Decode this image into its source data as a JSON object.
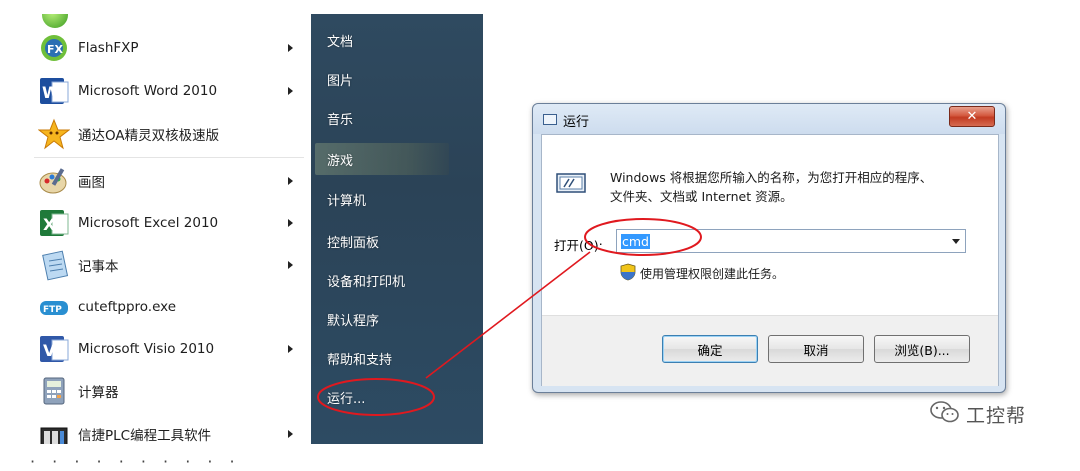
{
  "start_menu": {
    "programs": [
      {
        "label": "FlashFXP",
        "icon": "flashfxp-icon",
        "has_submenu": true
      },
      {
        "label": "Microsoft Word 2010",
        "icon": "word-icon",
        "has_submenu": true
      },
      {
        "label": "通达OA精灵双核极速版",
        "icon": "star-icon",
        "has_submenu": false
      },
      {
        "label": "画图",
        "icon": "paint-icon",
        "has_submenu": true
      },
      {
        "label": "Microsoft Excel 2010",
        "icon": "excel-icon",
        "has_submenu": true
      },
      {
        "label": "记事本",
        "icon": "notepad-icon",
        "has_submenu": true
      },
      {
        "label": "cuteftppro.exe",
        "icon": "cuteftp-icon",
        "has_submenu": false
      },
      {
        "label": "Microsoft Visio 2010",
        "icon": "visio-icon",
        "has_submenu": true
      },
      {
        "label": "计算器",
        "icon": "calculator-icon",
        "has_submenu": false
      },
      {
        "label": "信捷PLC编程工具软件",
        "icon": "plc-tool-icon",
        "has_submenu": true
      }
    ],
    "right_items": [
      {
        "label": "文档"
      },
      {
        "label": "图片"
      },
      {
        "label": "音乐"
      },
      {
        "label": "游戏",
        "highlighted": true
      },
      {
        "label": "计算机"
      },
      {
        "label": "控制面板"
      },
      {
        "label": "设备和打印机"
      },
      {
        "label": "默认程序"
      },
      {
        "label": "帮助和支持"
      },
      {
        "label": "运行..."
      }
    ]
  },
  "run_dialog": {
    "title": "运行",
    "close_glyph": "✕",
    "description_line1": "Windows 将根据您所输入的名称，为您打开相应的程序、",
    "description_line2": "文件夹、文档或 Internet 资源。",
    "open_label": "打开(O):",
    "command_value": "cmd",
    "admin_note": "使用管理权限创建此任务。",
    "ok_label": "确定",
    "cancel_label": "取消",
    "browse_label": "浏览(B)..."
  },
  "watermark": {
    "text": "工控帮"
  },
  "cutoff_text": "·  ·  ·  ·  ·    ·  ·  ·  ·  ·",
  "colors": {
    "start_right_panel": "#2b4357",
    "selection": "#3399ff",
    "annotation": "#e0191f",
    "dialog_frame": "#d7e4f2"
  }
}
